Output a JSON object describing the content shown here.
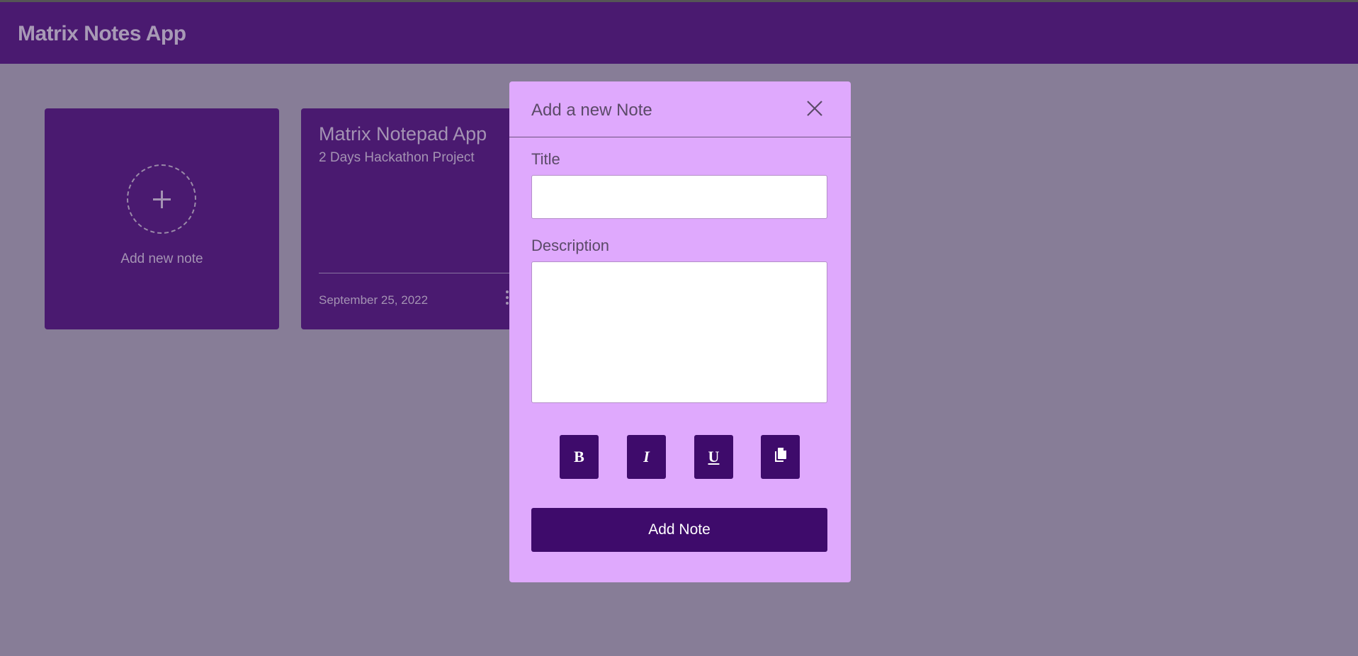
{
  "app": {
    "title": "Matrix Notes App"
  },
  "add_card": {
    "label": "Add new note",
    "icon": "plus-icon"
  },
  "notes": [
    {
      "title": "Matrix Notepad App",
      "description": "2 Days Hackathon Project",
      "date": "September 25, 2022",
      "menu_icon": "kebab-icon"
    }
  ],
  "modal": {
    "title": "Add a new Note",
    "close_icon": "close-icon",
    "title_label": "Title",
    "title_value": "",
    "description_label": "Description",
    "description_value": "",
    "format_buttons": {
      "bold": "B",
      "italic": "I",
      "underline": "U",
      "copy_icon": "copy-icon"
    },
    "submit_label": "Add Note"
  },
  "colors": {
    "navbar": "#4a1a70",
    "overlay_background": "#877d97",
    "card": "#4a1a70",
    "modal": "#dfa9fd",
    "button": "#3e0b6b"
  }
}
